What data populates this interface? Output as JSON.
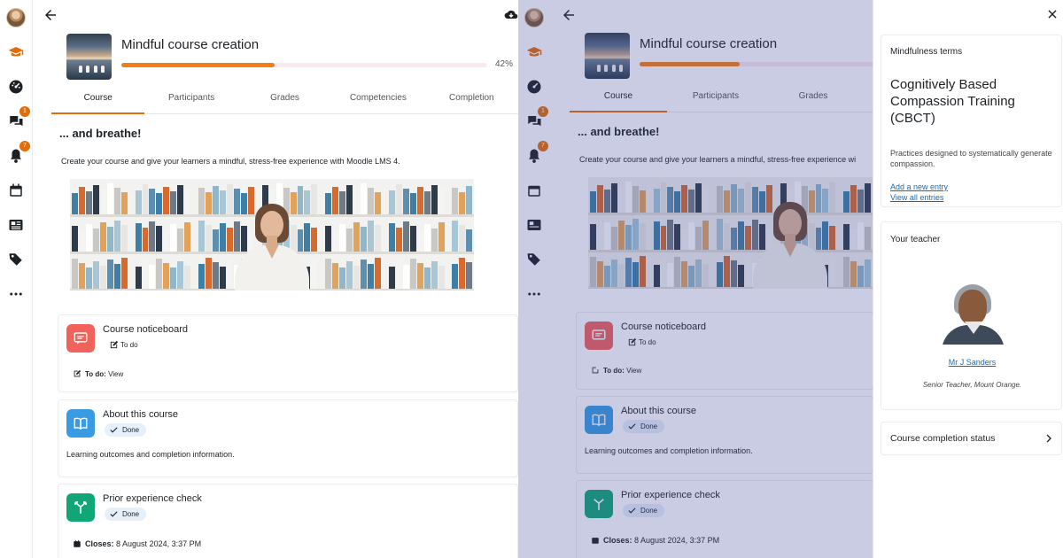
{
  "left_view": {
    "rail": {
      "icons": [
        "user-avatar",
        "graduation-cap-icon",
        "dashboard-icon",
        "messages-icon",
        "bell-icon",
        "calendar-icon",
        "newspaper-icon",
        "tags-icon",
        "more-icon"
      ],
      "messages_badge": "1",
      "notifications_badge": "7"
    },
    "course": {
      "title": "Mindful course creation",
      "progress_percent": 42,
      "progress_label": "42%",
      "accent": "#f57e14"
    },
    "tabs": [
      "Course",
      "Participants",
      "Grades",
      "Competencies",
      "Completion"
    ],
    "section": {
      "heading": "... and breathe!",
      "intro": "Create your course and give your learners a mindful, stress-free experience with Moodle LMS 4."
    },
    "activities": [
      {
        "name": "Course noticeboard",
        "status": "To do",
        "icon": "forum-icon",
        "icon_color": "#f0625b",
        "footer_label": "To do:",
        "footer_value": "View"
      },
      {
        "name": "About this course",
        "status": "Done",
        "icon": "book-icon",
        "icon_color": "#399be2",
        "description": "Learning outcomes and completion information."
      },
      {
        "name": "Prior experience check",
        "status": "Done",
        "icon": "choice-icon",
        "icon_color": "#11a676",
        "footer_label": "Closes:",
        "footer_value": "8 August 2024, 3:37 PM"
      }
    ]
  },
  "right_view": {
    "course_title": "Mindful course creation",
    "tabs": [
      "Course",
      "Participants",
      "Grades"
    ],
    "heading": "... and breathe!",
    "intro": "Create your course and give your learners a mindful, stress-free experience wi",
    "activities": [
      {
        "name": "Course noticeboard",
        "status": "To do",
        "footer_label": "To do:",
        "footer_value": "View"
      },
      {
        "name": "About this course",
        "status": "Done",
        "description": "Learning outcomes and completion information."
      },
      {
        "name": "Prior experience check",
        "status": "Done",
        "footer_label": "Closes:",
        "footer_value": "8 August 2024, 3:37 PM"
      }
    ],
    "drawer": {
      "glossary_block": {
        "title": "Mindfulness terms",
        "term": "Cognitively Based Compassion Training (CBCT)",
        "definition": "Practices designed to systematically generate compassion.",
        "add_link": "Add a new entry",
        "view_link": "View all entries"
      },
      "teacher_block": {
        "title": "Your teacher",
        "name": "Mr J Sanders",
        "role": "Senior Teacher, Mount Orange."
      },
      "completion_block": {
        "title": "Course completion status"
      }
    }
  }
}
